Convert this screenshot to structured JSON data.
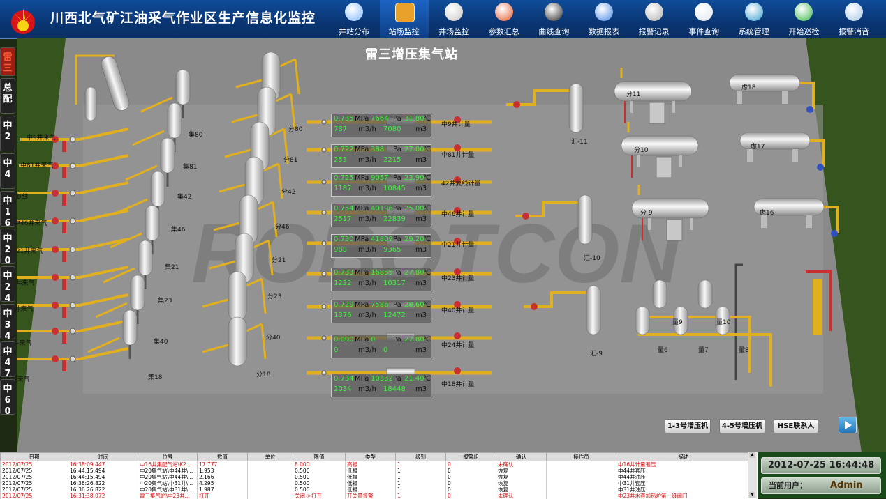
{
  "app": {
    "title": "川西北气矿江油采气作业区生产信息化监控"
  },
  "nav": [
    {
      "label": "井站分布",
      "icon": "map-magnifier-icon",
      "active": false
    },
    {
      "label": "站场监控",
      "icon": "station-monitor-icon",
      "active": true
    },
    {
      "label": "井场监控",
      "icon": "well-valve-icon",
      "active": false
    },
    {
      "label": "参数汇总",
      "icon": "parameter-book-icon",
      "active": false
    },
    {
      "label": "曲线查询",
      "icon": "curve-chart-icon",
      "active": false
    },
    {
      "label": "数据报表",
      "icon": "data-report-icon",
      "active": false
    },
    {
      "label": "报警记录",
      "icon": "alarm-speaker-icon",
      "active": false
    },
    {
      "label": "事件查询",
      "icon": "event-search-icon",
      "active": false
    },
    {
      "label": "系统管理",
      "icon": "system-settings-icon",
      "active": false
    },
    {
      "label": "开始巡检",
      "icon": "patrol-recycle-icon",
      "active": false
    },
    {
      "label": "报警消音",
      "icon": "mute-icon",
      "active": false
    }
  ],
  "sidetabs": [
    "雷三",
    "总配",
    "中2",
    "中4",
    "中16",
    "中20",
    "中24",
    "中34",
    "中47",
    "中60"
  ],
  "station": {
    "title": "雷三增压集气站"
  },
  "watermark": "ROBOTCON",
  "inlets": [
    "中9井来气",
    "中81井来气",
    "42井复线",
    "中46井来气",
    "中21井来气",
    "中23井来气",
    "中40井来气",
    "中24井来气",
    "中18井来气"
  ],
  "collectors": [
    "集80",
    "集81",
    "集42",
    "集46",
    "集21",
    "集23",
    "集40",
    "集18"
  ],
  "separators": [
    "分80",
    "分81",
    "分42",
    "分46",
    "分21",
    "分23",
    "分40",
    "分18"
  ],
  "meters": [
    {
      "mpa": "0.735",
      "pa": "7664",
      "temp": "31.80",
      "flow": "787",
      "total": "7080",
      "name": "中9井计量"
    },
    {
      "mpa": "0.722",
      "pa": "388",
      "temp": "27.00",
      "flow": "253",
      "total": "2215",
      "name": "中81井计量"
    },
    {
      "mpa": "0.725",
      "pa": "9057",
      "temp": "23.90",
      "flow": "1187",
      "total": "10845",
      "name": "42井复线计量"
    },
    {
      "mpa": "0.754",
      "pa": "40196",
      "temp": "25.00",
      "flow": "2517",
      "total": "22839",
      "name": "中46井计量"
    },
    {
      "mpa": "0.730",
      "pa": "41809",
      "temp": "29.20",
      "flow": "988",
      "total": "9365",
      "name": "中21井计量"
    },
    {
      "mpa": "0.733",
      "pa": "16855",
      "temp": "27.80",
      "flow": "1222",
      "total": "10317",
      "name": "中23井计量"
    },
    {
      "mpa": "0.729",
      "pa": "7586",
      "temp": "28.60",
      "flow": "1376",
      "total": "12472",
      "name": "中40井计量"
    },
    {
      "mpa": "0.000",
      "pa": "0",
      "temp": "27.80",
      "flow": "0",
      "total": "0",
      "name": "中24井计量"
    },
    {
      "mpa": "0.734",
      "pa": "10332",
      "temp": "21.40",
      "flow": "2034",
      "total": "18448",
      "name": "中18井计量"
    }
  ],
  "units": {
    "mpa": "MPa",
    "pa": "Pa",
    "temp": "℃",
    "flow": "m3/h",
    "total": "m3"
  },
  "right_equipment": {
    "sep_horizontal": [
      "分11",
      "分10",
      "分 9"
    ],
    "vertical": [
      "汇-11",
      "汇-10",
      "汇-9"
    ],
    "filters": [
      "虑18",
      "虑17",
      "虑16"
    ],
    "meters": [
      "量9",
      "量10",
      "量6",
      "量7",
      "量8"
    ]
  },
  "buttons": {
    "compressor_1_3": "1-3号增压机",
    "compressor_4_5": "4-5号增压机",
    "hse": "HSE联系人"
  },
  "alarm_table": {
    "headers": [
      "日期",
      "时间",
      "位号",
      "数值",
      "单位",
      "限值",
      "类型",
      "级别",
      "报警组",
      "确认",
      "操作员",
      "描述"
    ],
    "rows": [
      {
        "c": [
          "2012/07/25",
          "16:38:09.447",
          "中16井集配气站\\K2...",
          "17.777",
          "",
          "8.000",
          "高报",
          "1",
          "0",
          "未确认",
          "",
          "中16井计量差压"
        ],
        "red": true
      },
      {
        "c": [
          "2012/07/25",
          "16:44:15.494",
          "中20集气站\\中44井\\...",
          "1.953",
          "",
          "0.500",
          "低报",
          "1",
          "0",
          "恢复",
          "",
          "中44井套压"
        ],
        "red": false
      },
      {
        "c": [
          "2012/07/25",
          "16:44:15.494",
          "中20集气站\\中44井\\...",
          "2.166",
          "",
          "0.500",
          "低报",
          "1",
          "0",
          "恢复",
          "",
          "中44井油压"
        ],
        "red": false
      },
      {
        "c": [
          "2012/07/25",
          "16:36:26.822",
          "中20集气站\\中31井\\...",
          "4.295",
          "",
          "0.500",
          "低报",
          "1",
          "0",
          "恢复",
          "",
          "中31井套压"
        ],
        "red": false
      },
      {
        "c": [
          "2012/07/25",
          "16:36:26.822",
          "中20集气站\\中31井\\...",
          "1.987",
          "",
          "0.500",
          "低报",
          "1",
          "0",
          "恢复",
          "",
          "中31井油压"
        ],
        "red": false
      },
      {
        "c": [
          "2012/07/25",
          "16:31:38.072",
          "雷三集气站\\中23井...",
          "打开",
          "",
          "关闭->打开",
          "开关量报警",
          "1",
          "0",
          "未确认",
          "",
          "中23井水套加热炉第一级阀门"
        ],
        "red": true
      }
    ]
  },
  "status": {
    "datetime": "2012-07-25 16:44:48",
    "user_label": "当前用户：",
    "user": "Admin"
  },
  "colors": {
    "header": "#0a3572",
    "floor": "#8a8a8a",
    "grass": "#3c5a22",
    "pipe": "#e0b020",
    "valve": "#c83030",
    "meter_value": "#3ef23e"
  }
}
